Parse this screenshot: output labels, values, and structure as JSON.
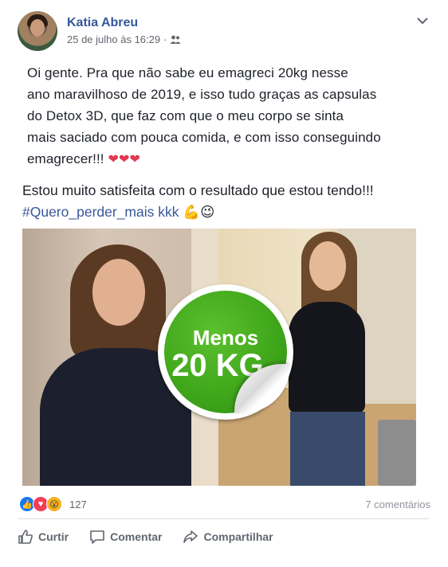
{
  "post": {
    "author": "Katia Abreu",
    "timestamp": "25 de julho às 16:29",
    "separator": "·",
    "privacy_icon": "friends-icon",
    "menu_icon": "chevron-down-icon",
    "body": "Oi gente. Pra que não  sabe eu emagreci 20kg nesse\nano maravilhoso de 2019, e isso tudo graças as capsulas\ndo Detox 3D, que faz com que o meu corpo se sinta\nmais saciado com pouca comida, e com isso conseguindo\nemagrecer!!! ",
    "hearts": "❤❤❤",
    "second_line": "Estou muito satisfeita com o resultado que estou tendo!!!",
    "hashtag": "#Quero_perder_mais kkk",
    "emoji": "💪😉"
  },
  "image": {
    "badge_line1": "Menos",
    "badge_line2": "20 KG"
  },
  "reactions": {
    "count": "127",
    "comments": "7 comentários",
    "icons": [
      "like-reaction-icon",
      "love-reaction-icon",
      "wow-reaction-icon"
    ]
  },
  "actions": {
    "like": "Curtir",
    "comment": "Comentar",
    "share": "Compartilhar"
  },
  "colors": {
    "author": "#365899",
    "hashtag": "#385898",
    "badge_green": "#3ea51a"
  }
}
